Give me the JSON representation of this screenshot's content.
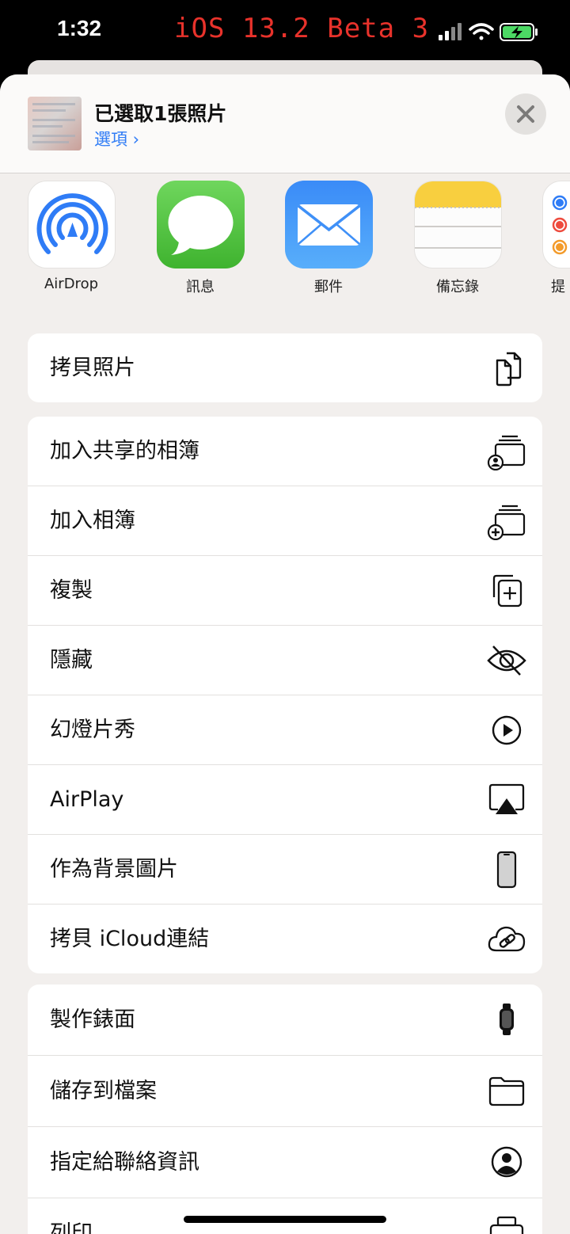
{
  "status_bar": {
    "time": "1:32",
    "beta_label": "iOS 13.2 Beta 3"
  },
  "header": {
    "title": "已選取1張照片",
    "options_label": "選項 ›"
  },
  "apps": [
    {
      "label": "AirDrop",
      "icon": "airdrop-icon"
    },
    {
      "label": "訊息",
      "icon": "messages-icon"
    },
    {
      "label": "郵件",
      "icon": "mail-icon"
    },
    {
      "label": "備忘錄",
      "icon": "notes-icon"
    },
    {
      "label": "提",
      "icon": "reminders-icon"
    }
  ],
  "actions_group1": [
    {
      "label": "拷貝照片",
      "icon": "copy-icon"
    }
  ],
  "actions_group2": [
    {
      "label": "加入共享的相簿",
      "icon": "shared-album-icon"
    },
    {
      "label": "加入相簿",
      "icon": "add-album-icon"
    },
    {
      "label": "複製",
      "icon": "duplicate-icon"
    },
    {
      "label": "隱藏",
      "icon": "eye-slash-icon"
    },
    {
      "label": "幻燈片秀",
      "icon": "play-circle-icon"
    },
    {
      "label": "AirPlay",
      "icon": "airplay-icon"
    },
    {
      "label": "作為背景圖片",
      "icon": "iphone-icon"
    },
    {
      "label": "拷貝 iCloud連結",
      "icon": "icloud-link-icon"
    }
  ],
  "actions_group3": [
    {
      "label": "製作錶面",
      "icon": "watch-icon"
    },
    {
      "label": "儲存到檔案",
      "icon": "folder-icon"
    },
    {
      "label": "指定給聯絡資訊",
      "icon": "contact-icon"
    },
    {
      "label": "列印",
      "icon": "printer-icon"
    }
  ],
  "colors": {
    "accent": "#2f7cf6",
    "beta_text": "#e8322b",
    "sheet_bg": "#f2efed",
    "messages_green": "#5ac74a",
    "mail_blue": "#2b7cf3"
  }
}
